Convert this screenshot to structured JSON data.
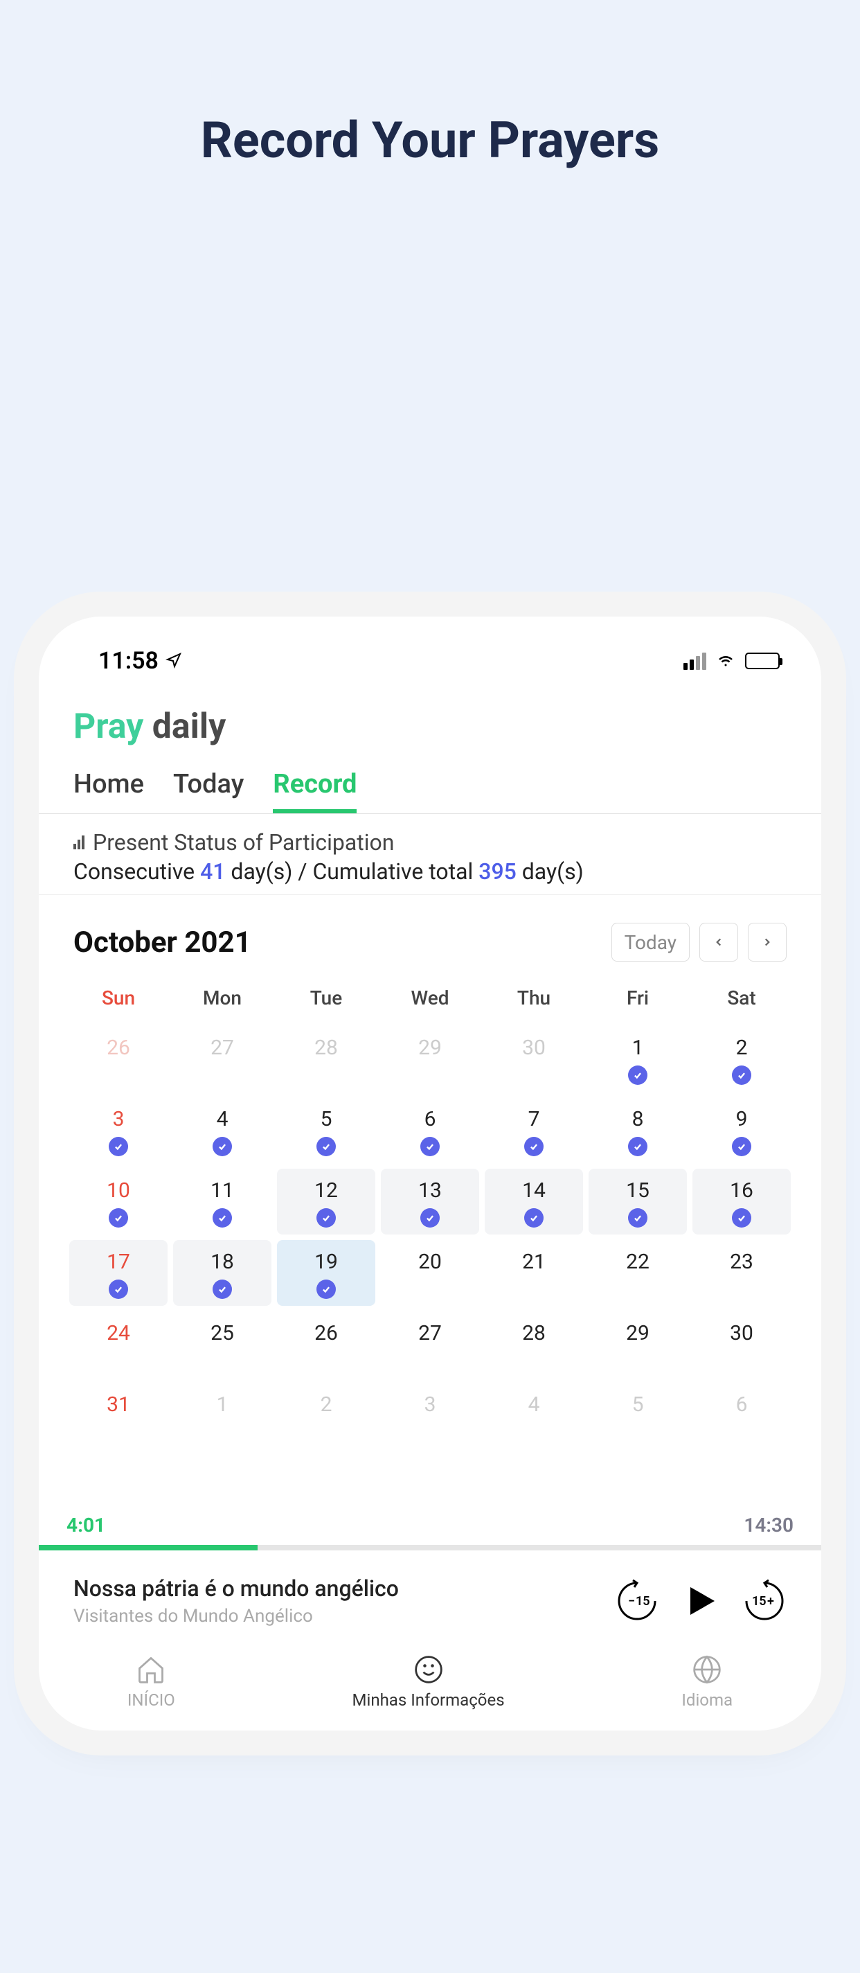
{
  "page": {
    "heading": "Record Your Prayers"
  },
  "status_bar": {
    "time": "11:58"
  },
  "logo": {
    "pray": "Pray",
    "daily": "daily"
  },
  "tabs": [
    {
      "label": "Home",
      "active": false
    },
    {
      "label": "Today",
      "active": false
    },
    {
      "label": "Record",
      "active": true
    }
  ],
  "stats": {
    "title": "Present Status of Participation",
    "consecutive_label_pre": "Consecutive",
    "consecutive_value": "41",
    "consecutive_label_post": "day(s)",
    "separator": "/",
    "cumulative_label_pre": "Cumulative total",
    "cumulative_value": "395",
    "cumulative_label_post": "day(s)"
  },
  "calendar": {
    "month_label": "October 2021",
    "today_label": "Today",
    "dow": [
      "Sun",
      "Mon",
      "Tue",
      "Wed",
      "Thu",
      "Fri",
      "Sat"
    ],
    "days": [
      {
        "n": "26",
        "other": true,
        "sun": true
      },
      {
        "n": "27",
        "other": true
      },
      {
        "n": "28",
        "other": true
      },
      {
        "n": "29",
        "other": true
      },
      {
        "n": "30",
        "other": true
      },
      {
        "n": "1",
        "check": true
      },
      {
        "n": "2",
        "check": true
      },
      {
        "n": "3",
        "sun": true,
        "check": true
      },
      {
        "n": "4",
        "check": true
      },
      {
        "n": "5",
        "check": true
      },
      {
        "n": "6",
        "check": true
      },
      {
        "n": "7",
        "check": true
      },
      {
        "n": "8",
        "check": true
      },
      {
        "n": "9",
        "check": true
      },
      {
        "n": "10",
        "sun": true,
        "check": true
      },
      {
        "n": "11",
        "check": true
      },
      {
        "n": "12",
        "check": true,
        "hl": true
      },
      {
        "n": "13",
        "check": true,
        "hl": true
      },
      {
        "n": "14",
        "check": true,
        "hl": true
      },
      {
        "n": "15",
        "check": true,
        "hl": true
      },
      {
        "n": "16",
        "check": true,
        "hl": true
      },
      {
        "n": "17",
        "sun": true,
        "check": true,
        "hl": true
      },
      {
        "n": "18",
        "check": true,
        "hl": true
      },
      {
        "n": "19",
        "check": true,
        "current": true
      },
      {
        "n": "20"
      },
      {
        "n": "21"
      },
      {
        "n": "22"
      },
      {
        "n": "23"
      },
      {
        "n": "24",
        "sun": true
      },
      {
        "n": "25"
      },
      {
        "n": "26"
      },
      {
        "n": "27"
      },
      {
        "n": "28"
      },
      {
        "n": "29"
      },
      {
        "n": "30"
      },
      {
        "n": "31",
        "sun": true
      },
      {
        "n": "1",
        "other": true
      },
      {
        "n": "2",
        "other": true
      },
      {
        "n": "3",
        "other": true
      },
      {
        "n": "4",
        "other": true
      },
      {
        "n": "5",
        "other": true
      },
      {
        "n": "6",
        "other": true
      }
    ]
  },
  "player": {
    "current_time": "4:01",
    "total_time": "14:30",
    "track_title": "Nossa pátria é o mundo angélico",
    "track_subtitle": "Visitantes do Mundo Angélico",
    "rewind_label": "15",
    "forward_label": "15"
  },
  "bottom_nav": [
    {
      "label": "INÍCIO"
    },
    {
      "label": "Minhas Informações"
    },
    {
      "label": "Idioma"
    }
  ]
}
